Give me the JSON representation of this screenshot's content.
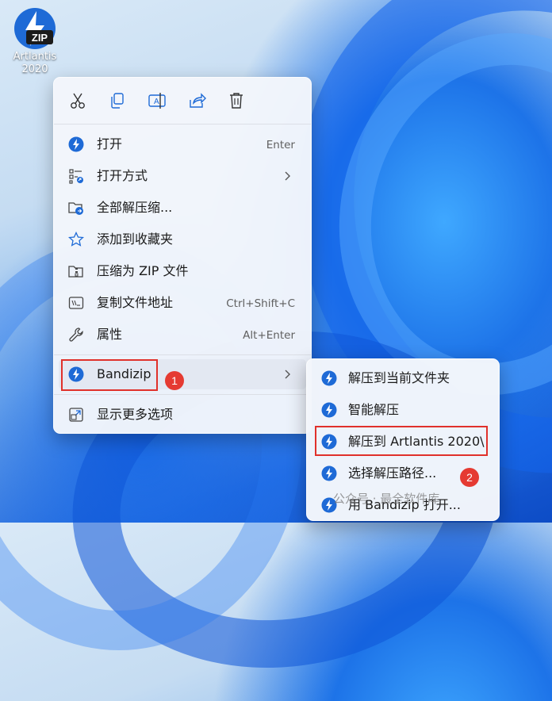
{
  "desktop_icon": {
    "label_line1": "Artlantis",
    "label_line2": "2020",
    "logo_text": "ZIP"
  },
  "toolbar": [
    {
      "icon": "cut-icon"
    },
    {
      "icon": "copy-icon"
    },
    {
      "icon": "rename-icon"
    },
    {
      "icon": "share-icon"
    },
    {
      "icon": "delete-icon"
    }
  ],
  "menu": {
    "items": [
      {
        "label": "打开",
        "shortcut": "Enter",
        "icon": "bandizip-icon"
      },
      {
        "label": "打开方式",
        "shortcut": "",
        "icon": "open-with-icon"
      },
      {
        "label": "全部解压缩...",
        "shortcut": "",
        "icon": "extract-all-icon"
      },
      {
        "label": "添加到收藏夹",
        "shortcut": "",
        "icon": "star-icon"
      },
      {
        "label": "压缩为 ZIP 文件",
        "shortcut": "",
        "icon": "zip-folder-icon"
      },
      {
        "label": "复制文件地址",
        "shortcut": "Ctrl+Shift+C",
        "icon": "copy-path-icon"
      },
      {
        "label": "属性",
        "shortcut": "Alt+Enter",
        "icon": "wrench-icon"
      }
    ],
    "bandizip": {
      "label": "Bandizip"
    },
    "more": {
      "label": "显示更多选项"
    }
  },
  "submenu": {
    "items": [
      {
        "label": "解压到当前文件夹"
      },
      {
        "label": "智能解压"
      },
      {
        "label": "解压到 Artlantis 2020\\"
      },
      {
        "label": "选择解压路径..."
      },
      {
        "label": "用 Bandizip 打开..."
      }
    ]
  },
  "badges": {
    "one": "1",
    "two": "2"
  },
  "watermark": "公众号 · 最全软件库",
  "colors": {
    "accent": "#1e6ad6",
    "highlight": "#e3e8f2",
    "annotation_red": "#e0312b"
  }
}
